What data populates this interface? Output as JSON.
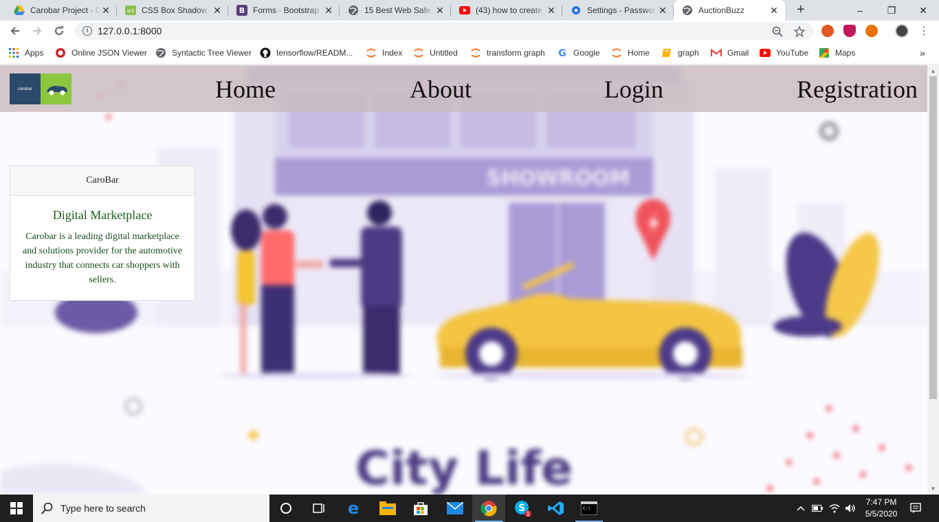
{
  "browser": {
    "tabs": [
      {
        "title": "Carobar Project - G",
        "icon": "google-drive-icon"
      },
      {
        "title": "CSS Box Shadow",
        "icon": "w3-icon"
      },
      {
        "title": "Forms · Bootstrap",
        "icon": "bootstrap-icon"
      },
      {
        "title": "15 Best Web Safe F",
        "icon": "globe-icon"
      },
      {
        "title": "(43) how to create",
        "icon": "youtube-icon"
      },
      {
        "title": "Settings - Passwor",
        "icon": "settings-gear-icon"
      },
      {
        "title": "AuctionBuzz",
        "icon": "globe-icon",
        "active": true
      }
    ],
    "new_tab": "+",
    "window_controls": {
      "minimize": "–",
      "restore": "❐",
      "close": "✕"
    },
    "url": "127.0.0.1:8000",
    "bookmarks": [
      {
        "label": "Apps",
        "icon": "apps-grid-icon"
      },
      {
        "label": "Online JSON Viewer",
        "icon": "json-viewer-icon"
      },
      {
        "label": "Syntactic Tree Viewer",
        "icon": "globe-icon"
      },
      {
        "label": "tensorflow/READM...",
        "icon": "github-icon"
      },
      {
        "label": "Index",
        "icon": "jupyter-icon"
      },
      {
        "label": "Untitled",
        "icon": "jupyter-icon"
      },
      {
        "label": "transform graph",
        "icon": "jupyter-icon"
      },
      {
        "label": "Google",
        "icon": "google-icon"
      },
      {
        "label": "Home",
        "icon": "jupyter-icon"
      },
      {
        "label": "graph",
        "icon": "book-icon"
      },
      {
        "label": "Gmail",
        "icon": "gmail-icon"
      },
      {
        "label": "YouTube",
        "icon": "youtube-icon"
      },
      {
        "label": "Maps",
        "icon": "maps-icon"
      }
    ],
    "bookmarks_overflow": "»"
  },
  "page": {
    "nav": {
      "logo_text": "carobar",
      "links": [
        "Home",
        "About",
        "Login",
        "Registration"
      ]
    },
    "hero": {
      "sign": "SHOWROOM",
      "caption": "City Life"
    },
    "card": {
      "header": "CaroBar",
      "title": "Digital Marketplace",
      "text": "Carobar is a leading digital marketplace and solutions provider for the automotive industry that connects car shoppers with sellers."
    }
  },
  "taskbar": {
    "search_placeholder": "Type here to search",
    "apps": [
      {
        "name": "cortana-icon"
      },
      {
        "name": "task-view-icon"
      },
      {
        "name": "edge-icon"
      },
      {
        "name": "file-explorer-icon"
      },
      {
        "name": "store-icon"
      },
      {
        "name": "mail-icon"
      },
      {
        "name": "chrome-icon",
        "running": true
      },
      {
        "name": "skype-icon",
        "badge": "1"
      },
      {
        "name": "vscode-icon"
      },
      {
        "name": "terminal-icon"
      }
    ],
    "time": "7:47 PM",
    "date": "5/5/2020"
  },
  "colors": {
    "navbar_bg": "#c9bbbf",
    "card_title": "#1c5c1c",
    "car_yellow": "#f4c542",
    "hero_purple": "#a99bd6"
  }
}
